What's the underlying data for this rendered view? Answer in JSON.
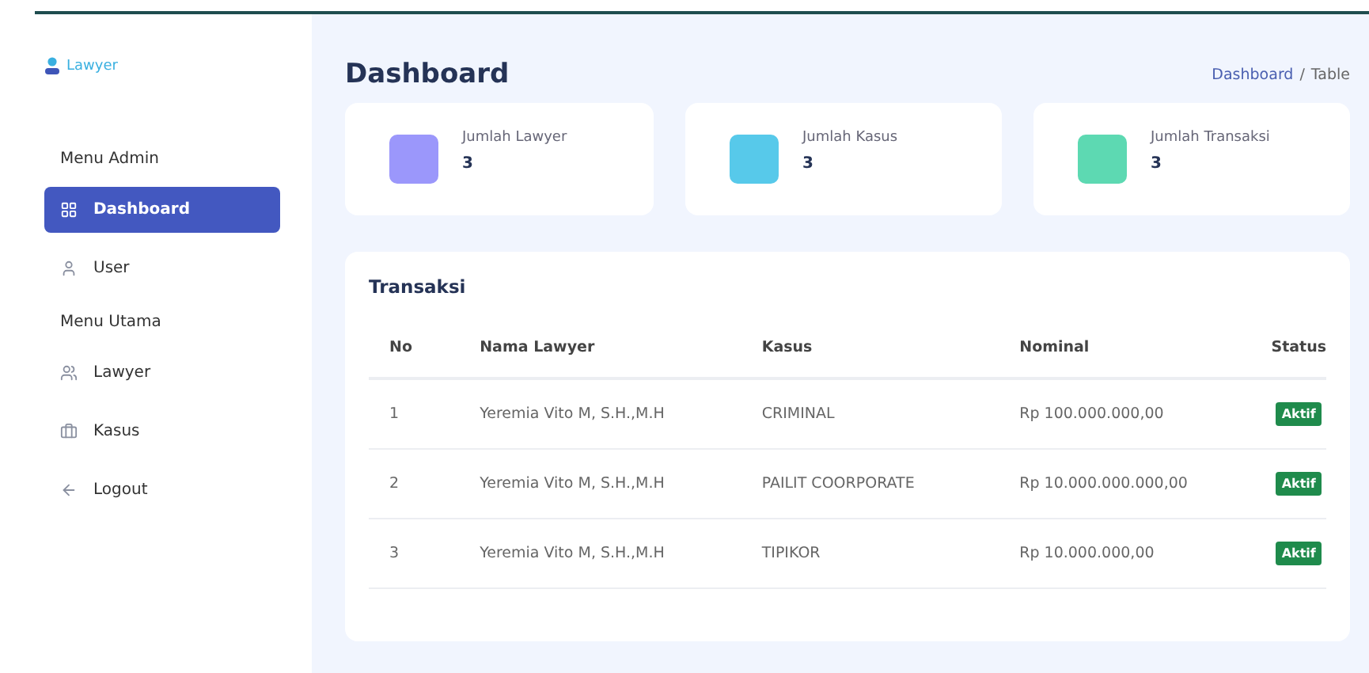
{
  "brand": {
    "name": "Lawyer"
  },
  "sidebar": {
    "items": [
      {
        "kind": "section",
        "label": "Menu Admin"
      },
      {
        "kind": "link",
        "label": "Dashboard",
        "selected": true
      },
      {
        "kind": "link",
        "label": "User",
        "selected": false
      },
      {
        "kind": "section",
        "label": "Menu Utama"
      },
      {
        "kind": "link",
        "label": "Lawyer",
        "selected": false
      },
      {
        "kind": "link",
        "label": "Kasus",
        "selected": false
      },
      {
        "kind": "link",
        "label": "Logout",
        "selected": false
      }
    ]
  },
  "page": {
    "title": "Dashboard",
    "breadcrumb": [
      {
        "label": "Dashboard",
        "kind": "link"
      },
      {
        "label": "Table",
        "kind": "current"
      }
    ],
    "separator": "/"
  },
  "stats": [
    {
      "label": "Jumlah Lawyer",
      "value": "3",
      "color": "#9b97fb"
    },
    {
      "label": "Jumlah Kasus",
      "value": "3",
      "color": "#57c9ea"
    },
    {
      "label": "Jumlah Transaksi",
      "value": "3",
      "color": "#5dd9b2"
    }
  ],
  "table": {
    "title": "Transaksi",
    "columns": [
      "No",
      "Nama Lawyer",
      "Kasus",
      "Nominal",
      "Status"
    ],
    "rows": [
      [
        "1",
        "Yeremia Vito M, S.H.,M.H",
        "CRIMINAL",
        "Rp 100.000.000,00",
        "Aktif"
      ],
      [
        "2",
        "Yeremia Vito M, S.H.,M.H",
        "PAILIT COORPORATE",
        "Rp 10.000.000.000,00",
        "Aktif"
      ],
      [
        "3",
        "Yeremia Vito M, S.H.,M.H",
        "TIPIKOR",
        "Rp 10.000.000,00",
        "Aktif"
      ]
    ]
  }
}
